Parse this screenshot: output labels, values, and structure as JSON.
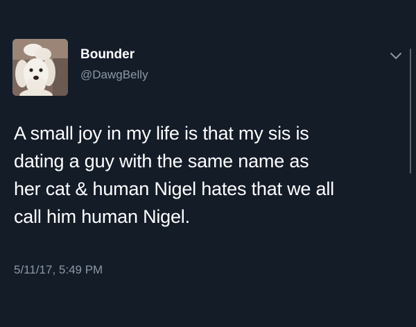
{
  "author": {
    "display_name": "Bounder",
    "handle": "@DawgBelly"
  },
  "tweet": {
    "lines": [
      "A small joy in my life is that my sis is",
      "dating a guy with the same name as",
      "her cat & human Nigel hates that we all",
      "call him human Nigel."
    ],
    "timestamp": "5/11/17, 5:49 PM"
  },
  "icons": {
    "menu": "chevron-down-icon",
    "avatar": "dog-avatar"
  },
  "colors": {
    "background": "#141c28",
    "text": "#ffffff",
    "secondary_text": "#8b98a5"
  }
}
